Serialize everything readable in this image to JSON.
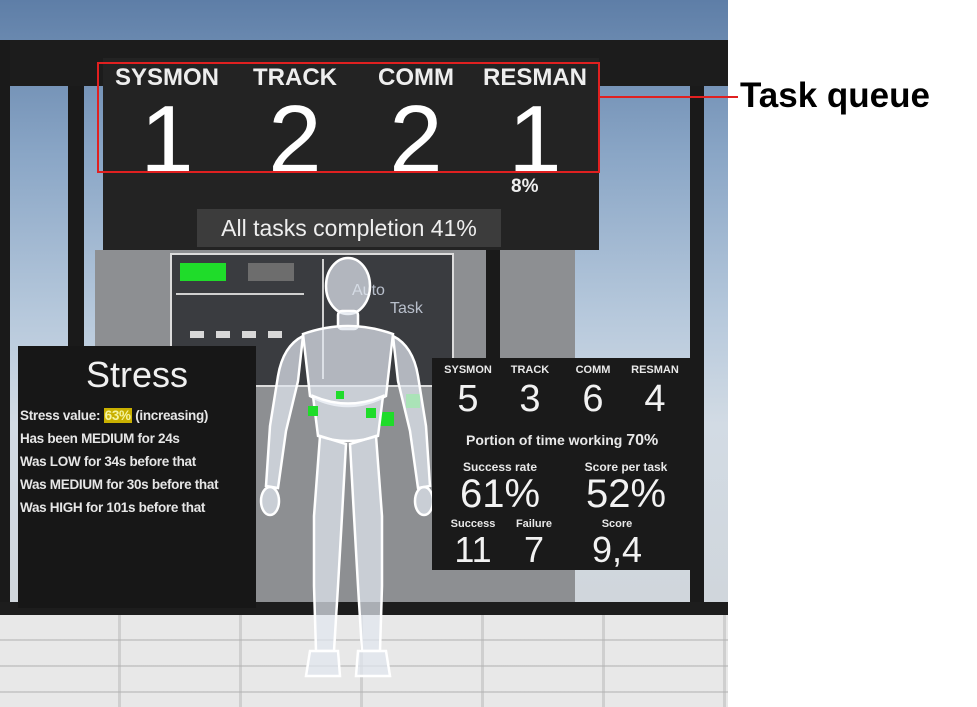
{
  "task_queue": {
    "columns": [
      {
        "name": "SYSMON",
        "count": "1"
      },
      {
        "name": "TRACK",
        "count": "2"
      },
      {
        "name": "COMM",
        "count": "2"
      },
      {
        "name": "RESMAN",
        "count": "1"
      }
    ],
    "resman_progress": "8%",
    "completion_label": "All tasks completion 41%",
    "annotation_label": "Task queue",
    "annotation_color": "#e02020"
  },
  "background_screen": {
    "text_line1": "Auto",
    "text_line2": "Task"
  },
  "stress": {
    "title": "Stress",
    "value_prefix": "Stress value:",
    "value": "63%",
    "value_suffix": "(increasing)",
    "value_highlight_color": "#c9b000",
    "lines": [
      "Has been MEDIUM for 24s",
      "Was LOW for 34s before that",
      "Was MEDIUM for 30s before that",
      "Was HIGH for 101s before that"
    ]
  },
  "stats": {
    "columns": [
      {
        "name": "SYSMON",
        "value": "5"
      },
      {
        "name": "TRACK",
        "value": "3"
      },
      {
        "name": "COMM",
        "value": "6"
      },
      {
        "name": "RESMAN",
        "value": "4"
      }
    ],
    "time_working_label": "Portion of time working",
    "time_working_value": "70%",
    "success_rate_label": "Success rate",
    "success_rate_value": "61%",
    "score_per_task_label": "Score per task",
    "score_per_task_value": "52%",
    "success_label": "Success",
    "success_value": "11",
    "failure_label": "Failure",
    "failure_value": "7",
    "score_label": "Score",
    "score_value": "9,4"
  },
  "colors": {
    "indicator_green": "#1fdc2a",
    "panel_background": "#1e1e1e"
  }
}
